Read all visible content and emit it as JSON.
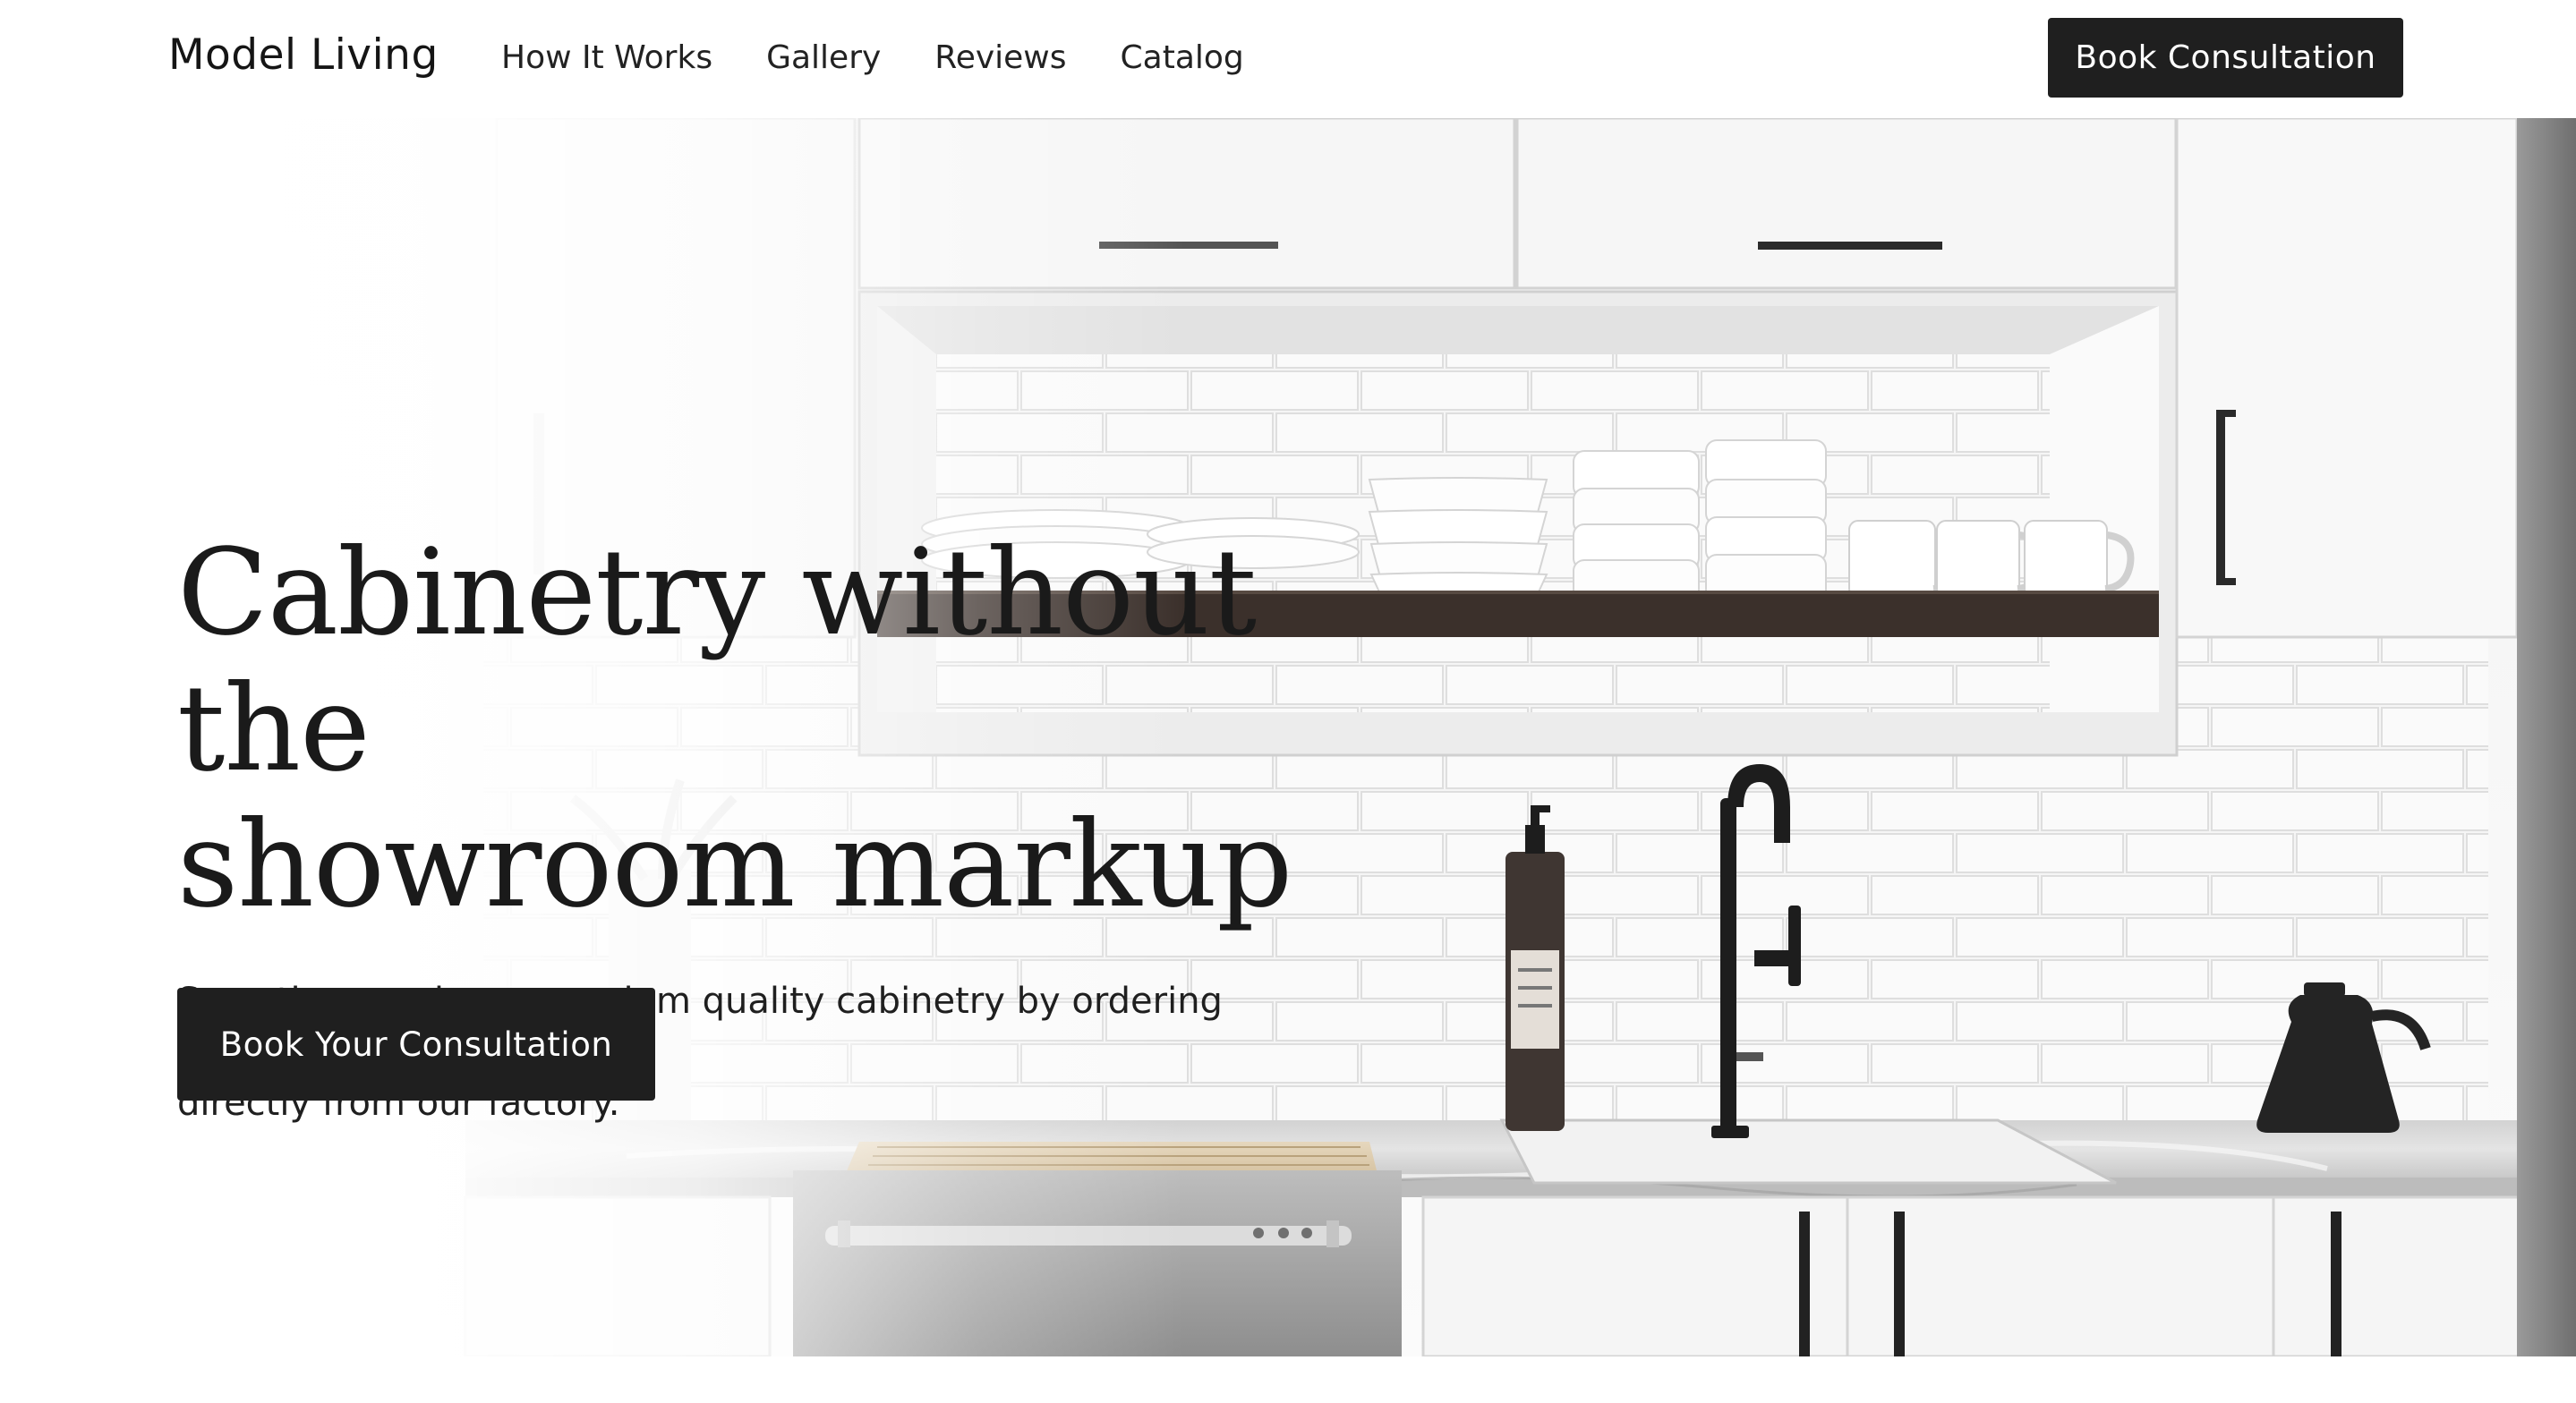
{
  "header": {
    "logo": "Model Living",
    "nav": [
      "How It Works",
      "Gallery",
      "Reviews",
      "Catalog"
    ],
    "cta": "Book Consultation"
  },
  "hero": {
    "title_line1": "Cabinetry without the",
    "title_line2": "showroom markup",
    "subtitle_line1": "Save thousands on premium quality cabinetry by ordering online",
    "subtitle_line2": "directly from our factory.",
    "cta": "Book Your Consultation"
  },
  "colors": {
    "button": "#1f1f1f",
    "background": "#ffffff",
    "shelf": "#3b302b",
    "fixtures": "#1d1d1d"
  }
}
